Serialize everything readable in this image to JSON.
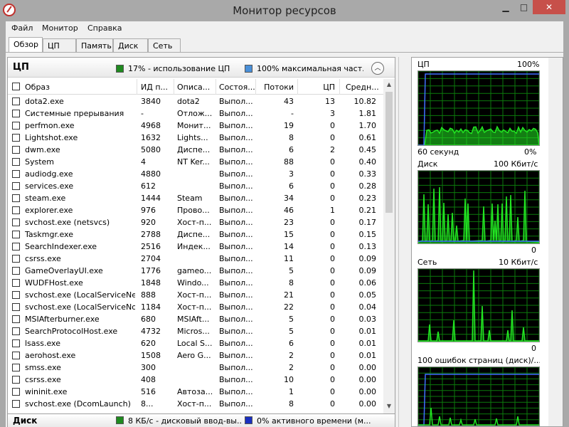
{
  "window": {
    "title": "Монитор ресурсов",
    "minimize_glyph": "▁",
    "maximize_glyph": "□",
    "close_glyph": "✕"
  },
  "menu": [
    "Файл",
    "Монитор",
    "Справка"
  ],
  "tabs": [
    "Обзор",
    "ЦП",
    "Память",
    "Диск",
    "Сеть"
  ],
  "cpu_section": {
    "title": "ЦП",
    "usage_text": "17% - использование ЦП",
    "max_freq_text": "100% максимальная част...",
    "usage_color": "#1f8a1f",
    "freq_color": "#4a90d9",
    "collapse_glyph": "︿"
  },
  "columns": [
    "Образ",
    "ИД п...",
    "Описа...",
    "Состоя...",
    "Потоки",
    "ЦП",
    "Средн..."
  ],
  "processes": [
    [
      "dota2.exe",
      "3840",
      "dota2",
      "Выпол...",
      "43",
      "13",
      "10.82"
    ],
    [
      "Системные прерывания",
      "-",
      "Отлож...",
      "Выпол...",
      "-",
      "3",
      "1.81"
    ],
    [
      "perfmon.exe",
      "4968",
      "Монит...",
      "Выпол...",
      "19",
      "0",
      "1.70"
    ],
    [
      "Lightshot.exe",
      "1632",
      "Lights...",
      "Выпол...",
      "8",
      "0",
      "0.61"
    ],
    [
      "dwm.exe",
      "5080",
      "Диспе...",
      "Выпол...",
      "6",
      "2",
      "0.45"
    ],
    [
      "System",
      "4",
      "NT Ker...",
      "Выпол...",
      "88",
      "0",
      "0.40"
    ],
    [
      "audiodg.exe",
      "4880",
      "",
      "Выпол...",
      "3",
      "0",
      "0.33"
    ],
    [
      "services.exe",
      "612",
      "",
      "Выпол...",
      "6",
      "0",
      "0.28"
    ],
    [
      "steam.exe",
      "1444",
      "Steam",
      "Выпол...",
      "34",
      "0",
      "0.23"
    ],
    [
      "explorer.exe",
      "976",
      "Прово...",
      "Выпол...",
      "46",
      "1",
      "0.21"
    ],
    [
      "svchost.exe (netsvcs)",
      "920",
      "Хост-п...",
      "Выпол...",
      "23",
      "0",
      "0.17"
    ],
    [
      "Taskmgr.exe",
      "2788",
      "Диспе...",
      "Выпол...",
      "15",
      "0",
      "0.15"
    ],
    [
      "SearchIndexer.exe",
      "2516",
      "Индек...",
      "Выпол...",
      "14",
      "0",
      "0.13"
    ],
    [
      "csrss.exe",
      "2704",
      "",
      "Выпол...",
      "11",
      "0",
      "0.09"
    ],
    [
      "GameOverlayUI.exe",
      "1776",
      "gameo...",
      "Выпол...",
      "5",
      "0",
      "0.09"
    ],
    [
      "WUDFHost.exe",
      "1848",
      "Windo...",
      "Выпол...",
      "8",
      "0",
      "0.06"
    ],
    [
      "svchost.exe (LocalServiceNet...",
      "888",
      "Хост-п...",
      "Выпол...",
      "21",
      "0",
      "0.05"
    ],
    [
      "svchost.exe (LocalServiceNo...",
      "1184",
      "Хост-п...",
      "Выпол...",
      "22",
      "0",
      "0.04"
    ],
    [
      "MSIAfterburner.exe",
      "680",
      "MSIAft...",
      "Выпол...",
      "5",
      "0",
      "0.03"
    ],
    [
      "SearchProtocolHost.exe",
      "4732",
      "Micros...",
      "Выпол...",
      "5",
      "0",
      "0.01"
    ],
    [
      "lsass.exe",
      "620",
      "Local S...",
      "Выпол...",
      "6",
      "0",
      "0.01"
    ],
    [
      "aerohost.exe",
      "1508",
      "Aero G...",
      "Выпол...",
      "2",
      "0",
      "0.01"
    ],
    [
      "smss.exe",
      "300",
      "",
      "Выпол...",
      "2",
      "0",
      "0.00"
    ],
    [
      "csrss.exe",
      "408",
      "",
      "Выпол...",
      "10",
      "0",
      "0.00"
    ],
    [
      "wininit.exe",
      "516",
      "Автоза...",
      "Выпол...",
      "1",
      "0",
      "0.00"
    ],
    [
      "svchost.exe (DcomLaunch)",
      "8...",
      "Хост-п...",
      "Выпол...",
      "8",
      "0",
      "0.00"
    ]
  ],
  "disk_section": {
    "title": "Диск",
    "usage_text": "8 КБ/с - дисковый ввод-вы...",
    "active_text": "0% активного времени (м...",
    "usage_color": "#1f8a1f",
    "active_color": "#1a2fc0"
  },
  "graphs": {
    "cpu": {
      "label": "ЦП",
      "max": "100%",
      "time": "60 секунд",
      "min": "0%"
    },
    "disk": {
      "label": "Диск",
      "max": "100 Кбит/с",
      "min": "0"
    },
    "network": {
      "label": "Сеть",
      "max": "10 Кбит/с",
      "min": "0"
    },
    "memory": {
      "label": "100 ошибок страниц (диск)/..."
    }
  },
  "colors": {
    "graph_bg": "#000000",
    "graph_grid": "#0c7a0c",
    "graph_line_green": "#22e622",
    "graph_line_blue": "#3f6fff"
  }
}
